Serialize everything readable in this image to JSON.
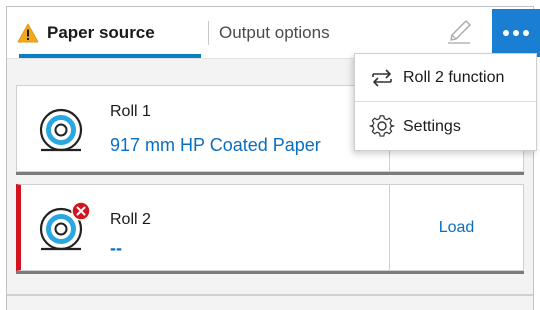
{
  "tabs": {
    "paper_source": "Paper source",
    "output_options": "Output options"
  },
  "toolbar": {
    "pen_icon": "pen-icon",
    "more_icon": "more-horizontal-icon",
    "more_color": "#1a7fd2"
  },
  "rolls": [
    {
      "name": "Roll 1",
      "media": "917 mm HP Coated Paper",
      "status": "ok",
      "action": ""
    },
    {
      "name": "Roll 2",
      "media": "--",
      "status": "error",
      "action": "Load"
    }
  ],
  "menu": {
    "items": [
      {
        "label": "Roll 2 function",
        "icon": "swap-arrows-icon"
      },
      {
        "label": "Settings",
        "icon": "gear-icon"
      }
    ]
  },
  "colors": {
    "accent": "#0a7fc2",
    "link": "#0a6fc0",
    "error": "#d3131f",
    "warning": "#f2a81d"
  }
}
